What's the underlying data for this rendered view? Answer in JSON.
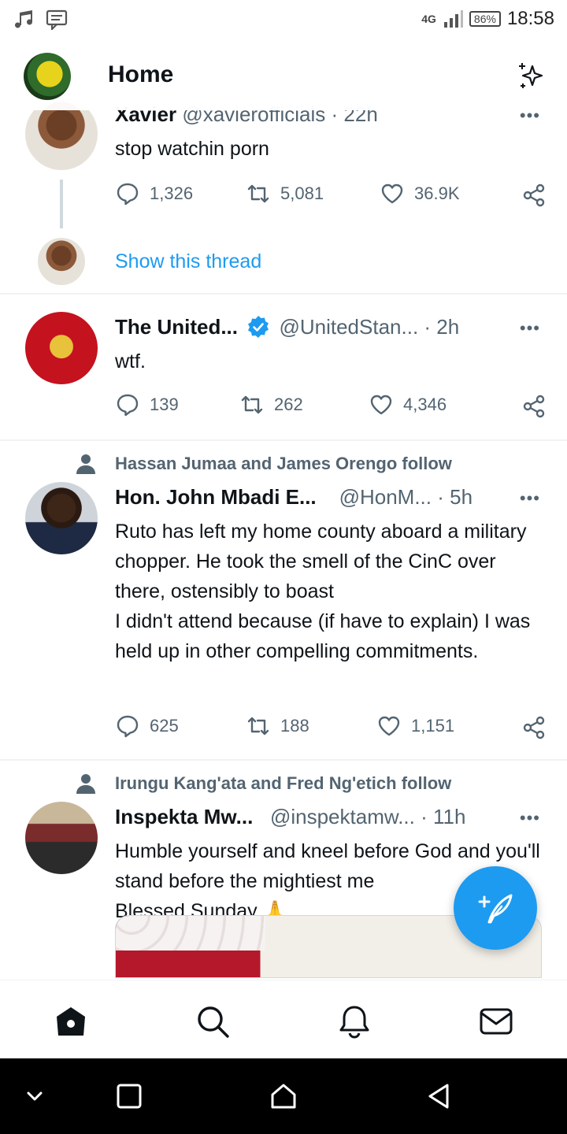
{
  "status_bar": {
    "network": "4G",
    "battery": "86%",
    "time": "18:58"
  },
  "header": {
    "title": "Home"
  },
  "tweets": [
    {
      "name": "Xavier",
      "handle": "@xavierofficials",
      "time": "· 22h",
      "text": "stop watchin porn",
      "replies": "1,326",
      "retweets": "5,081",
      "likes": "36.9K",
      "thread_link": "Show this thread"
    },
    {
      "name": "The United...",
      "handle": "@UnitedStan...",
      "time": "· 2h",
      "text": "wtf.",
      "replies": "139",
      "retweets": "262",
      "likes": "4,346"
    },
    {
      "social": "Hassan Jumaa and James Orengo follow",
      "name": "Hon. John Mbadi E...",
      "handle": "@HonM...",
      "time": "· 5h",
      "text": "Ruto has left my home county aboard a military chopper. He took the smell of the CinC over there, ostensibly to boast\nI didn't attend because (if have to explain) I was held up in other compelling commitments.",
      "replies": "625",
      "retweets": "188",
      "likes": "1,151"
    },
    {
      "social": "Irungu Kang'ata and Fred Ng'etich follow",
      "name": "Inspekta Mw...",
      "handle": "@inspektamw...",
      "time": "· 11h",
      "text": "Humble yourself and kneel before God and you'll stand before the mightiest me\nBlessed Sunday 🙏"
    }
  ],
  "nav": [
    "home-icon",
    "search-icon",
    "bell-icon",
    "mail-icon"
  ],
  "colors": {
    "accent": "#1d9bf0",
    "text": "#0f1419",
    "muted": "#536471"
  }
}
